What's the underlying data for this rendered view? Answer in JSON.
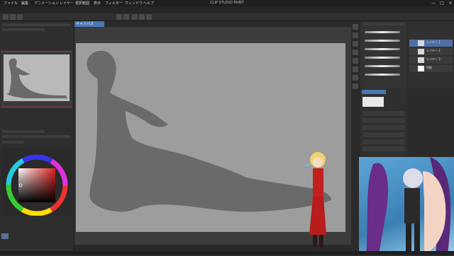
{
  "window": {
    "title": "CLIP STUDIO PAINT",
    "controls": [
      "—",
      "□",
      "✕"
    ]
  },
  "menu": {
    "items": [
      "ファイル",
      "編集",
      "アニメーション",
      "レイヤー",
      "選択範囲",
      "表示",
      "フィルター",
      "ウィンドウ",
      "ヘルプ"
    ]
  },
  "canvas": {
    "tab_label": "キャンバス"
  },
  "panels": {
    "layers": [
      "レイヤー 1",
      "レイヤー 2",
      "レイヤー 3",
      "用紙"
    ]
  },
  "colors": {
    "accent": "#c63030",
    "tab": "#4a78b6",
    "canvas": "#9d9d9d",
    "silhouette": "#6a6a6a"
  },
  "icons": [
    "pen-icon",
    "eraser-icon",
    "fill-icon",
    "select-icon",
    "text-icon",
    "eyedropper-icon",
    "hand-icon",
    "zoom-icon"
  ]
}
